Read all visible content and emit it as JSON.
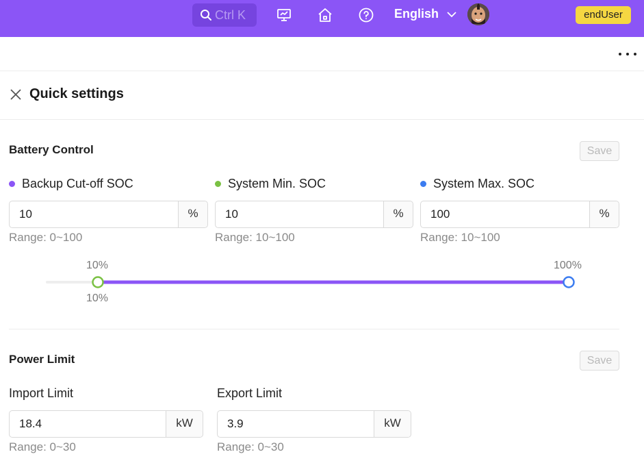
{
  "topbar": {
    "search_placeholder": "Ctrl K",
    "language": "English",
    "role": "endUser",
    "accent": "#8b55f6"
  },
  "panel": {
    "title": "Quick settings"
  },
  "battery_control": {
    "title": "Battery Control",
    "save_label": "Save",
    "fields": [
      {
        "label": "Backup Cut-off SOC",
        "value": "10",
        "unit": "%",
        "range": "Range: 0~100",
        "dot_color": "#8b55f6"
      },
      {
        "label": "System Min. SOC",
        "value": "10",
        "unit": "%",
        "range": "Range: 10~100",
        "dot_color": "#7ac143"
      },
      {
        "label": "System Max. SOC",
        "value": "100",
        "unit": "%",
        "range": "Range: 10~100",
        "dot_color": "#3b7cf0"
      }
    ],
    "slider": {
      "min_top_label": "10%",
      "min_bottom_label": "10%",
      "max_label": "100%",
      "backup_percent": 10,
      "min_percent": 10,
      "max_percent": 100
    }
  },
  "power_limit": {
    "title": "Power Limit",
    "save_label": "Save",
    "fields": [
      {
        "label": "Import Limit",
        "value": "18.4",
        "unit": "kW",
        "range": "Range: 0~30"
      },
      {
        "label": "Export Limit",
        "value": "3.9",
        "unit": "kW",
        "range": "Range: 0~30"
      }
    ]
  }
}
